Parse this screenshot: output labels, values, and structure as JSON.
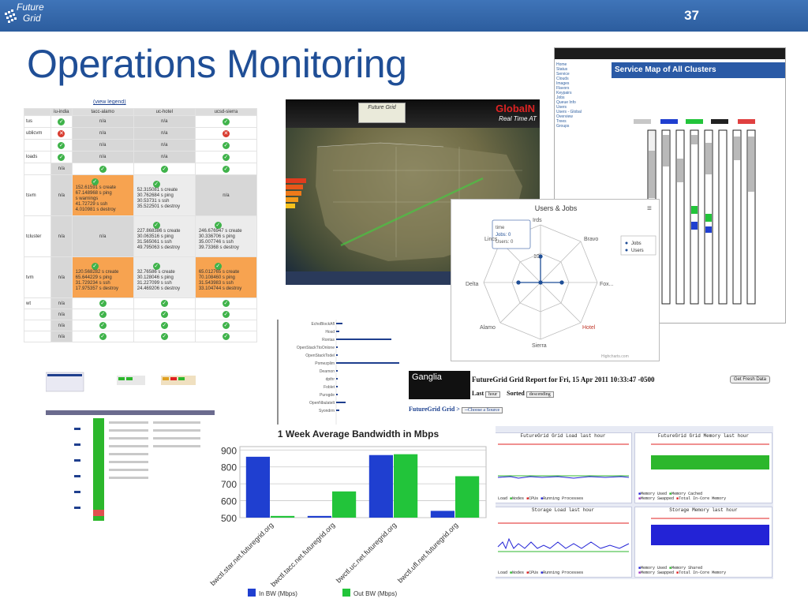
{
  "slide": {
    "logo_line1": "Future",
    "logo_line2": "Grid",
    "number": "37",
    "title": "Operations Monitoring"
  },
  "status_table": {
    "legend": "(view legend)",
    "columns": [
      "iu-india",
      "tacc-alamo",
      "uc-hotel",
      "ucsd-sierra"
    ],
    "rows": [
      {
        "name": "tus",
        "cells": [
          "ok",
          "n/a",
          "n/a",
          "ok"
        ]
      },
      {
        "name": "ublicvm",
        "cells": [
          "bad",
          "n/a",
          "n/a",
          "bad"
        ]
      },
      {
        "name": "",
        "cells": [
          "ok",
          "n/a",
          "n/a",
          "ok"
        ]
      },
      {
        "name": "loads",
        "cells": [
          "ok",
          "n/a",
          "n/a",
          "ok"
        ]
      },
      {
        "name": "",
        "cells": [
          "n/a",
          "ok",
          "ok",
          "ok"
        ]
      }
    ],
    "na": "n/a",
    "ok_glyph": "✓",
    "bad_glyph": "✕",
    "block_rows": [
      {
        "name": "tsvm",
        "col1": "n/a",
        "c2": [
          "152.61591  s   create",
          "67.148968  s   ping",
          "s                 warnings",
          "41.72729  s   ssh",
          "4.010981  s   destroy"
        ],
        "c3": [
          "52.315081  s   create",
          "30.762684  s   ping",
          "30.53731  s   ssh",
          "35.522501  s   destroy"
        ],
        "c4": "n/a"
      },
      {
        "name": "tcluster",
        "col1": "n/a",
        "c2": "n/a",
        "c3": [
          "227.868386  s   create",
          "30.063516  s   ping",
          "31.565061  s   ssh",
          "49.795063  s   destroy"
        ],
        "c4": [
          "246.676947  s   create",
          "30.336706  s   ping",
          "35.007746  s   ssh",
          "39.73368  s   destroy"
        ]
      },
      {
        "name": "tvm",
        "col1": "n/a",
        "c2": [
          "120.568282  s   create",
          "65.644229  s   ping",
          "31.729234  s   ssh",
          "17.975357  s   destroy"
        ],
        "c3": [
          "32.76586  s   create",
          "30.128046  s   ping",
          "31.227099  s   ssh",
          "24.469206  s   destroy"
        ],
        "c4": [
          "65.012765  s   create",
          "70.108460  s   ping",
          "31.543983  s   ssh",
          "33.104744  s   destroy"
        ]
      }
    ],
    "tail_rows": [
      "wt",
      "",
      "",
      ""
    ]
  },
  "map": {
    "logo_text": "Future Grid",
    "brand_top": "GlobalN",
    "brand_sub": "Real Time AT"
  },
  "service_map": {
    "title": "Service Map of All Clusters"
  },
  "radar": {
    "title": "Users & Jobs",
    "axes": [
      "Sierra",
      "Bravo",
      "Foxtrot",
      "Hotel",
      "Sierra",
      "Alamo",
      "Delta",
      "India"
    ],
    "axis_labels": [
      "Irds",
      "Bravo",
      "Fox...",
      "Hotel",
      "Sierra",
      "Alamo",
      "Delta",
      "Lincs"
    ],
    "tooltip": [
      "time",
      "Jobs: 0",
      "Users: 0"
    ],
    "legend": [
      "Jobs",
      "Users"
    ],
    "ring_label": "10",
    "credit": "Highcharts.com"
  },
  "ganglia": {
    "logo": "Ganglia",
    "report_title": "FutureGrid Grid Report for Fri, 15 Apr 2011 10:33:47 -0500",
    "fresh_button": "Get Fresh Data",
    "last_label": "Last",
    "last_value": "hour",
    "sorted_label": "Sorted",
    "sorted_value": "descending",
    "crumb": "FutureGrid Grid >",
    "source_select": "--Choose a Source",
    "graphs": [
      {
        "title": "FutureGrid Grid Load last hour",
        "legend": [
          "Load",
          "Nodes",
          "CPUs",
          "Running Processes"
        ]
      },
      {
        "title": "FutureGrid Grid Memory last hour",
        "legend": [
          "Memory Used",
          "Memory Shared",
          "Memory Cached",
          "Memory Buffered",
          "Memory Swapped",
          "Total In-Core Memory"
        ]
      },
      {
        "title": "Storage Load last hour",
        "legend": [
          "Load",
          "Nodes",
          "CPUs",
          "Running Processes"
        ]
      },
      {
        "title": "Storage Memory last hour",
        "legend": [
          "Memory Used",
          "Memory Shared",
          "Memory Cached",
          "Memory Buffered",
          "Memory Swapped",
          "Total In-Core Memory"
        ]
      }
    ],
    "times": [
      "10:10",
      "10:20"
    ],
    "colors": {
      "green": "#2cb72c",
      "blue": "#2323d6",
      "red": "#e02020",
      "purple": "#9b2ebf"
    }
  },
  "chart_data": {
    "type": "bar",
    "title": "1 Week Average Bandwidth in Mbps",
    "categories": [
      "bwctl.star.net.futuregrid.org",
      "bwctl.tacc.net.futuregrid.org",
      "bwctl.uc.net.futuregrid.org",
      "bwctl.ufl.net.futuregrid.org"
    ],
    "series": [
      {
        "name": "In BW (Mbps)",
        "values": [
          860,
          510,
          870,
          540
        ],
        "color": "#1f3fd0"
      },
      {
        "name": "Out BW (Mbps)",
        "values": [
          510,
          655,
          875,
          745
        ],
        "color": "#22c43a"
      }
    ],
    "ylim": [
      500,
      920
    ],
    "yticks": [
      500,
      600,
      700,
      800,
      900
    ],
    "legend_position": "bottom"
  },
  "colors": {
    "header_blue": "#2c5d9e",
    "title_blue": "#1f4e96",
    "ok_green": "#3fb34a",
    "bad_red": "#d83a2e",
    "warn_orange": "#f7a350"
  }
}
